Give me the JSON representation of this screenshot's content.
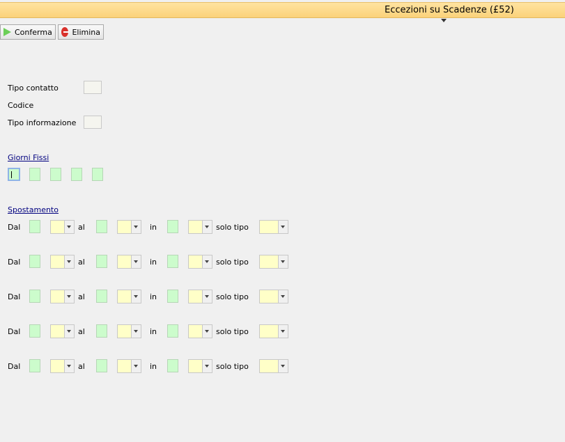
{
  "header": {
    "title": "Eccezioni su Scadenze (£52)"
  },
  "toolbar": {
    "confirm_label": "Conferma",
    "delete_label": "Elimina"
  },
  "form": {
    "tipo_contatto_label": "Tipo contatto",
    "codice_label": "Codice",
    "tipo_informazione_label": "Tipo informazione"
  },
  "giorni_fissi": {
    "label": "Giorni Fissi"
  },
  "spostamento": {
    "label": "Spostamento",
    "dal_label": "Dal",
    "al_label": "al",
    "in_label": "in",
    "solo_tipo_label": "solo tipo"
  },
  "colors": {
    "titlebar": "#fbd27a",
    "green_field": "#ccfccc",
    "yellow_combo": "#ffffc8"
  }
}
